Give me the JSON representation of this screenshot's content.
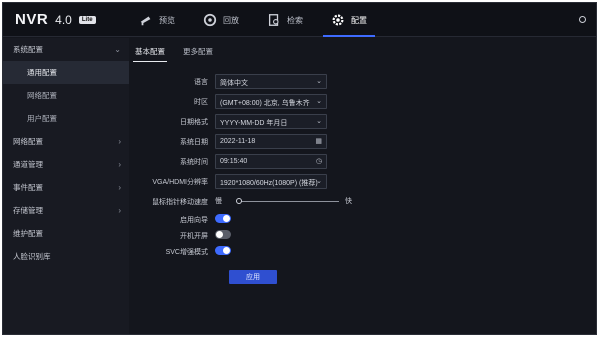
{
  "brand": {
    "name": "NVR",
    "version": "4.0",
    "tag": "Lite"
  },
  "nav": [
    {
      "label": "预览",
      "icon": "camera-icon"
    },
    {
      "label": "回放",
      "icon": "playback-icon"
    },
    {
      "label": "检索",
      "icon": "search-file-icon"
    },
    {
      "label": "配置",
      "icon": "gear-icon"
    }
  ],
  "sidebar": {
    "sections": [
      {
        "label": "系统配置",
        "expanded": true,
        "subs": [
          "通用配置",
          "网络配置",
          "用户配置"
        ]
      },
      {
        "label": "网络配置"
      },
      {
        "label": "通道管理"
      },
      {
        "label": "事件配置"
      },
      {
        "label": "存储管理"
      },
      {
        "label": "维护配置"
      },
      {
        "label": "人脸识别库"
      }
    ]
  },
  "tabs": [
    "基本配置",
    "更多配置"
  ],
  "form": {
    "language": {
      "label": "语言",
      "value": "简体中文"
    },
    "timezone": {
      "label": "时区",
      "value": "(GMT+08:00) 北京, 乌鲁木齐"
    },
    "date_format": {
      "label": "日期格式",
      "value": "YYYY-MM-DD 年月日"
    },
    "system_date": {
      "label": "系统日期",
      "value": "2022-11-18"
    },
    "system_time": {
      "label": "系统时间",
      "value": "09:15:40"
    },
    "resolution": {
      "label": "VGA/HDMI分辨率",
      "value": "1920*1080/60Hz(1080P) (推荐)"
    },
    "mouse_speed": {
      "label": "鼠标指针移动速度",
      "min_label": "慢",
      "max_label": "快",
      "level": 0.02
    },
    "enable_wizard": {
      "label": "启用向导",
      "on": true
    },
    "lock_screen": {
      "label": "开机开屏",
      "on": false
    },
    "svc_mode": {
      "label": "SVC增强模式",
      "on": true
    }
  },
  "apply_label": "应用",
  "colors": {
    "accent": "#3e6bff",
    "bg": "#14161d"
  }
}
